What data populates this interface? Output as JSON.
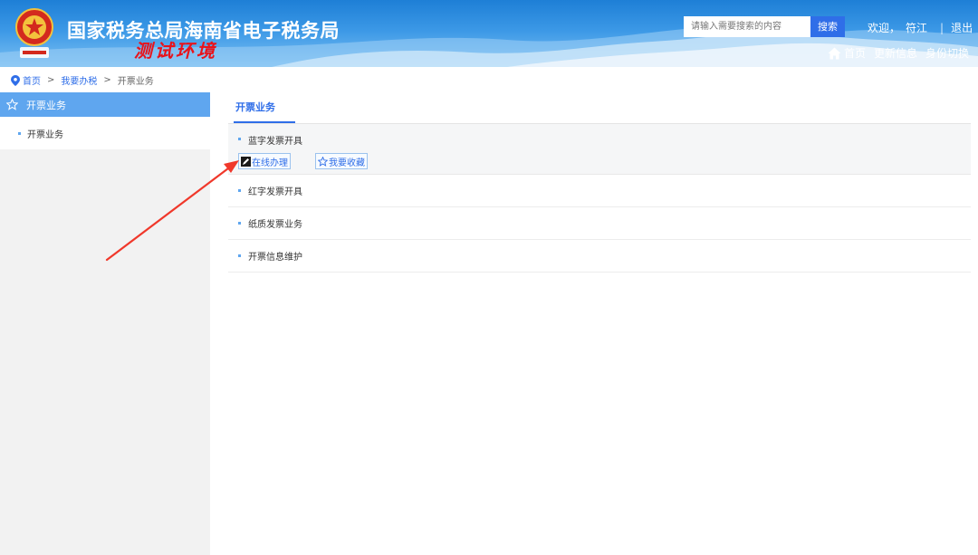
{
  "header": {
    "site_title": "国家税务总局海南省电子税务局",
    "env_tag": "测试环境",
    "search": {
      "placeholder": "请输入需要搜索的内容",
      "button_label": "搜索"
    },
    "user": {
      "welcome": "欢迎，",
      "name": "符江",
      "separator": "|",
      "logout": "退出"
    },
    "links": {
      "home": "首页",
      "update_info": "更新信息",
      "switch_identity": "身份切换"
    }
  },
  "breadcrumb": {
    "items": [
      "首页",
      "我要办税",
      "开票业务"
    ],
    "separator": ">"
  },
  "sidebar": {
    "header_label": "开票业务",
    "items": [
      {
        "label": "开票业务"
      }
    ]
  },
  "main": {
    "tab_label": "开票业务",
    "items": [
      {
        "label": "蓝字发票开具",
        "actions": {
          "online": "在线办理",
          "favorite": "我要收藏"
        }
      },
      {
        "label": "红字发票开具"
      },
      {
        "label": "纸质发票业务"
      },
      {
        "label": "开票信息维护"
      }
    ]
  },
  "colors": {
    "header_blue": "#1e7fd6",
    "accent_blue": "#2f6ee8",
    "sidebar_active": "#5fa6ef",
    "env_red": "#e8131b",
    "arrow_red": "#f0382b"
  },
  "icons": [
    "emblem-icon",
    "home-icon",
    "location-pin-icon",
    "star-icon",
    "edit-icon",
    "favorite-star-icon"
  ]
}
